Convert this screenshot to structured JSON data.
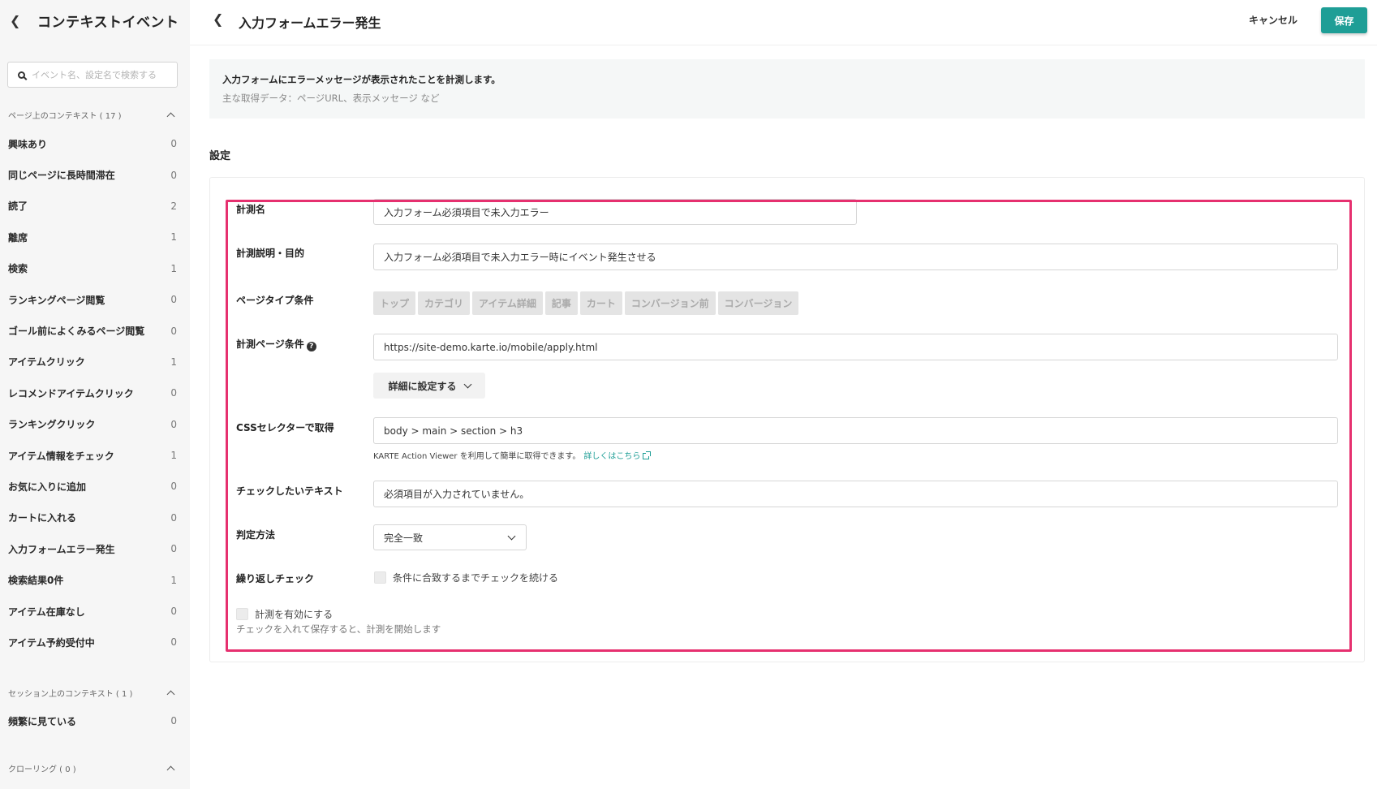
{
  "sidebar": {
    "title": "コンテキストイベント",
    "search_placeholder": "イベント名、設定名で検索する",
    "page_section": {
      "label": "ページ上のコンテキスト ( 17 )",
      "items": [
        {
          "label": "興味あり",
          "count": "0"
        },
        {
          "label": "同じページに長時間滞在",
          "count": "0"
        },
        {
          "label": "読了",
          "count": "2"
        },
        {
          "label": "離席",
          "count": "1"
        },
        {
          "label": "検索",
          "count": "1"
        },
        {
          "label": "ランキングページ閲覧",
          "count": "0"
        },
        {
          "label": "ゴール前によくみるページ閲覧",
          "count": "0"
        },
        {
          "label": "アイテムクリック",
          "count": "1"
        },
        {
          "label": "レコメンドアイテムクリック",
          "count": "0"
        },
        {
          "label": "ランキングクリック",
          "count": "0"
        },
        {
          "label": "アイテム情報をチェック",
          "count": "1"
        },
        {
          "label": "お気に入りに追加",
          "count": "0"
        },
        {
          "label": "カートに入れる",
          "count": "0"
        },
        {
          "label": "入力フォームエラー発生",
          "count": "0"
        },
        {
          "label": "検索結果0件",
          "count": "1"
        },
        {
          "label": "アイテム在庫なし",
          "count": "0"
        },
        {
          "label": "アイテム予約受付中",
          "count": "0"
        }
      ]
    },
    "session_section": {
      "label": "セッション上のコンテキスト ( 1 )",
      "items": [
        {
          "label": "頻繁に見ている",
          "count": "0"
        }
      ]
    },
    "crawling_section": {
      "label": "クローリング ( 0 )"
    }
  },
  "header": {
    "title": "入力フォームエラー発生",
    "cancel_label": "キャンセル",
    "save_label": "保存"
  },
  "info": {
    "description": "入力フォームにエラーメッセージが表示されたことを計測します。",
    "data_note": "主な取得データ：ページURL、表示メッセージ など"
  },
  "settings": {
    "heading": "設定",
    "measurement_name": {
      "label": "計測名",
      "value": "入力フォーム必須項目で未入力エラー"
    },
    "description_field": {
      "label": "計測説明・目的",
      "value": "入力フォーム必須項目で未入力エラー時にイベント発生させる"
    },
    "page_type": {
      "label": "ページタイプ条件",
      "options": [
        "トップ",
        "カテゴリ",
        "アイテム詳細",
        "記事",
        "カート",
        "コンバージョン前",
        "コンバージョン"
      ]
    },
    "page_condition": {
      "label": "計測ページ条件",
      "help_icon": "?",
      "value": "https://site-demo.karte.io/mobile/apply.html"
    },
    "detail_button": "詳細に設定する",
    "css_selector": {
      "label": "CSSセレクターで取得",
      "value": "body > main > section > h3",
      "hint": "KARTE Action Viewer を利用して簡単に取得できます。",
      "hint_link": "詳しくはこちら"
    },
    "check_text": {
      "label": "チェックしたいテキスト",
      "value": "必須項目が入力されていません。"
    },
    "match_method": {
      "label": "判定方法",
      "value": "完全一致"
    },
    "repeat_check": {
      "label": "繰り返しチェック",
      "checkbox_label": "条件に合致するまでチェックを続ける"
    },
    "enable": {
      "checkbox_label": "計測を有効にする",
      "note": "チェックを入れて保存すると、計測を開始します"
    }
  },
  "colors": {
    "accent": "#1e9e96",
    "highlight": "#e6306f"
  }
}
